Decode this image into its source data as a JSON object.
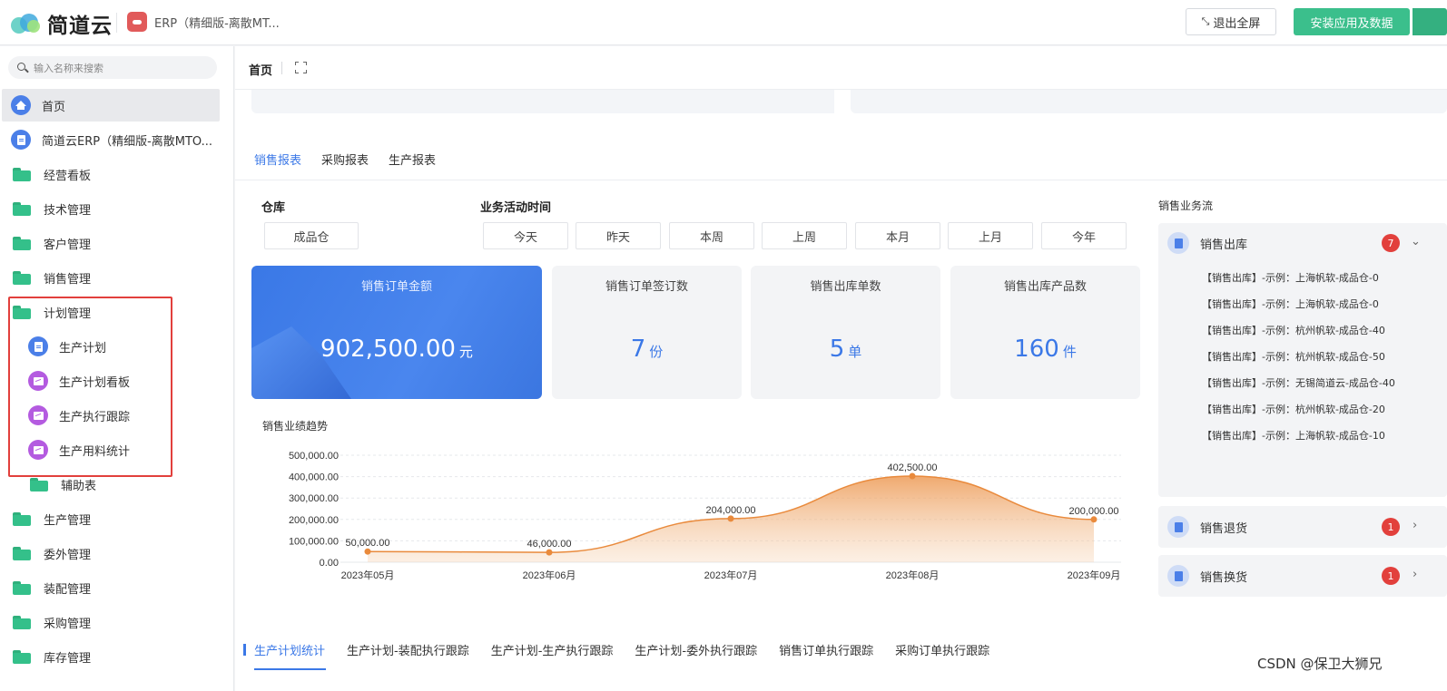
{
  "topbar": {
    "logo_text": "简道云",
    "app_tab_title": "ERP（精细版-离散MT...",
    "exit_fullscreen_label": "退出全屏",
    "install_label": "安装应用及数据"
  },
  "sidebar": {
    "search_placeholder": "输入名称来搜索",
    "items": [
      {
        "label": "首页",
        "icon": "home-icon"
      },
      {
        "label": "简道云ERP（精细版-离散MTO...",
        "icon": "form-icon"
      },
      {
        "label": "经营看板",
        "icon": "folder-icon"
      },
      {
        "label": "技术管理",
        "icon": "folder-icon"
      },
      {
        "label": "客户管理",
        "icon": "folder-icon"
      },
      {
        "label": "销售管理",
        "icon": "folder-icon"
      },
      {
        "label": "计划管理",
        "icon": "folder-icon"
      },
      {
        "label": "生产计划",
        "icon": "form-icon"
      },
      {
        "label": "生产计划看板",
        "icon": "dashboard-icon"
      },
      {
        "label": "生产执行跟踪",
        "icon": "dashboard-icon"
      },
      {
        "label": "生产用料统计",
        "icon": "dashboard-icon"
      },
      {
        "label": "辅助表",
        "icon": "folder-icon"
      },
      {
        "label": "生产管理",
        "icon": "folder-icon"
      },
      {
        "label": "委外管理",
        "icon": "folder-icon"
      },
      {
        "label": "装配管理",
        "icon": "folder-icon"
      },
      {
        "label": "采购管理",
        "icon": "folder-icon"
      },
      {
        "label": "库存管理",
        "icon": "folder-icon"
      }
    ]
  },
  "breadcrumb": {
    "home": "首页"
  },
  "report_tabs": [
    "销售报表",
    "采购报表",
    "生产报表"
  ],
  "filters": {
    "warehouse_label": "仓库",
    "warehouse_value": "成品仓",
    "time_label": "业务活动时间",
    "time_options": [
      "今天",
      "昨天",
      "本周",
      "上周",
      "本月",
      "上月",
      "今年"
    ]
  },
  "kpis": [
    {
      "title": "销售订单金额",
      "value": "902,500.00",
      "unit": "元"
    },
    {
      "title": "销售订单签订数",
      "value": "7",
      "unit": "份"
    },
    {
      "title": "销售出库单数",
      "value": "5",
      "unit": "单"
    },
    {
      "title": "销售出库产品数",
      "value": "160",
      "unit": "件"
    }
  ],
  "chart_title": "销售业绩趋势",
  "chart_data": {
    "type": "area",
    "title": "销售业绩趋势",
    "categories": [
      "2023年05月",
      "2023年06月",
      "2023年07月",
      "2023年08月",
      "2023年09月"
    ],
    "values": [
      50000,
      46000,
      204000,
      402500,
      200000
    ],
    "value_labels": [
      "50,000.00",
      "46,000.00",
      "204,000.00",
      "402,500.00",
      "200,000.00"
    ],
    "yticks": [
      0,
      100000,
      200000,
      300000,
      400000,
      500000
    ],
    "ytick_labels": [
      "0.00",
      "100,000.00",
      "200,000.00",
      "300,000.00",
      "400,000.00",
      "500,000.00"
    ],
    "ylim": [
      0,
      500000
    ],
    "grid": true,
    "color": "#e98a3c"
  },
  "sales_flow": {
    "title": "销售业务流",
    "groups": [
      {
        "name": "销售出库",
        "badge": "7",
        "items": [
          "【销售出库】-示例：上海帆软-成品仓-0",
          "【销售出库】-示例：上海帆软-成品仓-0",
          "【销售出库】-示例：杭州帆软-成品仓-40",
          "【销售出库】-示例：杭州帆软-成品仓-50",
          "【销售出库】-示例：无锡简道云-成品仓-40",
          "【销售出库】-示例：杭州帆软-成品仓-20",
          "【销售出库】-示例：上海帆软-成品仓-10"
        ]
      },
      {
        "name": "销售退货",
        "badge": "1"
      },
      {
        "name": "销售换货",
        "badge": "1"
      }
    ]
  },
  "bottom_tabs": [
    "生产计划统计",
    "生产计划-装配执行跟踪",
    "生产计划-生产执行跟踪",
    "生产计划-委外执行跟踪",
    "销售订单执行跟踪",
    "采购订单执行跟踪"
  ],
  "watermark": "CSDN @保卫大狮兄",
  "colors": {
    "accent": "#3b78e7",
    "highlight_border": "#e2403c",
    "install_button": "#3bbf8c",
    "chart_line": "#e98a3c"
  }
}
